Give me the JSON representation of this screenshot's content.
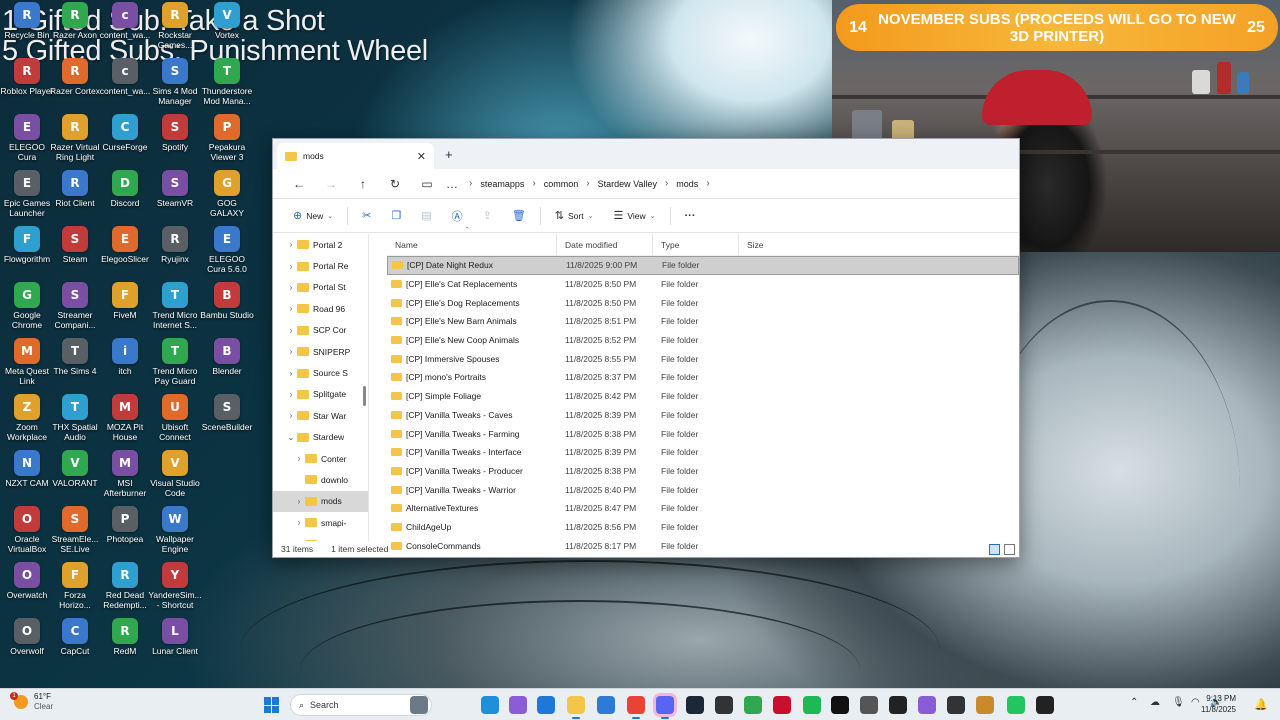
{
  "overlay": {
    "line1": "1 Gifted Sub: Take a Shot",
    "line2": "5 Gifted Subs: Punishment Wheel"
  },
  "subs_banner": {
    "left_number": "14",
    "text": "NOVEMBER SUBS (PROCEEDS WILL GO TO NEW 3D PRINTER)",
    "right_number": "25",
    "color": "#f39a1c"
  },
  "desktop_icons": [
    [
      "Recycle Bin",
      "Razer Axon",
      "content_wa...",
      "Rockstar Games...",
      "Vortex"
    ],
    [
      "Roblox Player",
      "Razer Cortex",
      "content_wa...",
      "Sims 4 Mod Manager",
      "Thunderstore Mod Mana..."
    ],
    [
      "ELEGOO Cura",
      "Razer Virtual Ring Light",
      "CurseForge",
      "Spotify",
      "Pepakura Viewer 3"
    ],
    [
      "Epic Games Launcher",
      "Riot Client",
      "Discord",
      "SteamVR",
      "GOG GALAXY"
    ],
    [
      "Flowgorithm",
      "Steam",
      "ElegooSlicer",
      "Ryujinx",
      "ELEGOO Cura 5.6.0"
    ],
    [
      "Google Chrome",
      "Streamer Compani...",
      "FiveM",
      "Trend Micro Internet S...",
      "Bambu Studio"
    ],
    [
      "Meta Quest Link",
      "The Sims 4",
      "itch",
      "Trend Micro Pay Guard",
      "Blender"
    ],
    [
      "Zoom Workplace",
      "THX Spatial Audio",
      "MOZA Pit House",
      "Ubisoft Connect",
      "SceneBuilder"
    ],
    [
      "NZXT CAM",
      "VALORANT",
      "MSI Afterburner",
      "Visual Studio Code",
      ""
    ],
    [
      "Oracle VirtualBox",
      "StreamEle... SE.Live",
      "Photopea",
      "Wallpaper Engine",
      ""
    ],
    [
      "Overwatch",
      "Forza Horizo...",
      "Red Dead Redempti...",
      "YandereSim... - Shortcut",
      ""
    ],
    [
      "Overwolf",
      "CapCut",
      "RedM",
      "Lunar Client",
      ""
    ]
  ],
  "explorer": {
    "tab_title": "mods",
    "breadcrumbs": [
      "steamapps",
      "common",
      "Stardew Valley",
      "mods"
    ],
    "commands": {
      "new_label": "New",
      "sort_label": "Sort",
      "view_label": "View"
    },
    "nav_items": [
      {
        "label": "Portal 2",
        "arrow": "›"
      },
      {
        "label": "Portal Re",
        "arrow": "›"
      },
      {
        "label": "Portal St",
        "arrow": "›"
      },
      {
        "label": "Road 96",
        "arrow": "›"
      },
      {
        "label": "SCP Cor",
        "arrow": "›"
      },
      {
        "label": "SNIPERP",
        "arrow": "›"
      },
      {
        "label": "Source S",
        "arrow": "›"
      },
      {
        "label": "Splitgate",
        "arrow": "›"
      },
      {
        "label": "Star War",
        "arrow": "›"
      },
      {
        "label": "Stardew",
        "arrow": "⌄"
      },
      {
        "label": "Conter",
        "arrow": "›"
      },
      {
        "label": "downlo",
        "arrow": ""
      },
      {
        "label": "mods",
        "arrow": "›"
      },
      {
        "label": "smapi-",
        "arrow": "›"
      },
      {
        "label": "StickFigh",
        "arrow": "›"
      }
    ],
    "columns": {
      "name": "Name",
      "date": "Date modified",
      "type": "Type",
      "size": "Size"
    },
    "files": [
      {
        "name": "[CP] Date Night Redux",
        "date": "11/8/2025 9:00 PM",
        "type": "File folder"
      },
      {
        "name": "[CP] Elle's Cat Replacements",
        "date": "11/8/2025 8:50 PM",
        "type": "File folder"
      },
      {
        "name": "[CP] Elle's Dog Replacements",
        "date": "11/8/2025 8:50 PM",
        "type": "File folder"
      },
      {
        "name": "[CP] Elle's New Barn Animals",
        "date": "11/8/2025 8:51 PM",
        "type": "File folder"
      },
      {
        "name": "[CP] Elle's New Coop Animals",
        "date": "11/8/2025 8:52 PM",
        "type": "File folder"
      },
      {
        "name": "[CP] Immersive Spouses",
        "date": "11/8/2025 8:55 PM",
        "type": "File folder"
      },
      {
        "name": "[CP] mono's Portraits",
        "date": "11/8/2025 8:37 PM",
        "type": "File folder"
      },
      {
        "name": "[CP] Simple Foliage",
        "date": "11/8/2025 8:42 PM",
        "type": "File folder"
      },
      {
        "name": "[CP] Vanilla Tweaks - Caves",
        "date": "11/8/2025 8:39 PM",
        "type": "File folder"
      },
      {
        "name": "[CP] Vanilla Tweaks - Farming",
        "date": "11/8/2025 8:38 PM",
        "type": "File folder"
      },
      {
        "name": "[CP] Vanilla Tweaks - Interface",
        "date": "11/8/2025 8:39 PM",
        "type": "File folder"
      },
      {
        "name": "[CP] Vanilla Tweaks - Producer",
        "date": "11/8/2025 8:38 PM",
        "type": "File folder"
      },
      {
        "name": "[CP] Vanilla Tweaks - Warrior",
        "date": "11/8/2025 8:40 PM",
        "type": "File folder"
      },
      {
        "name": "AlternativeTextures",
        "date": "11/8/2025 8:47 PM",
        "type": "File folder"
      },
      {
        "name": "ChildAgeUp",
        "date": "11/8/2025 8:56 PM",
        "type": "File folder"
      },
      {
        "name": "ConsoleCommands",
        "date": "11/8/2025 8:17 PM",
        "type": "File folder"
      }
    ],
    "status": {
      "items": "31 items",
      "selected": "1 item selected"
    }
  },
  "taskbar": {
    "temperature": "61°F",
    "condition": "Clear",
    "weather_badge": "1",
    "search_placeholder": "Search",
    "time": "9:13 PM",
    "date": "11/8/2025"
  }
}
